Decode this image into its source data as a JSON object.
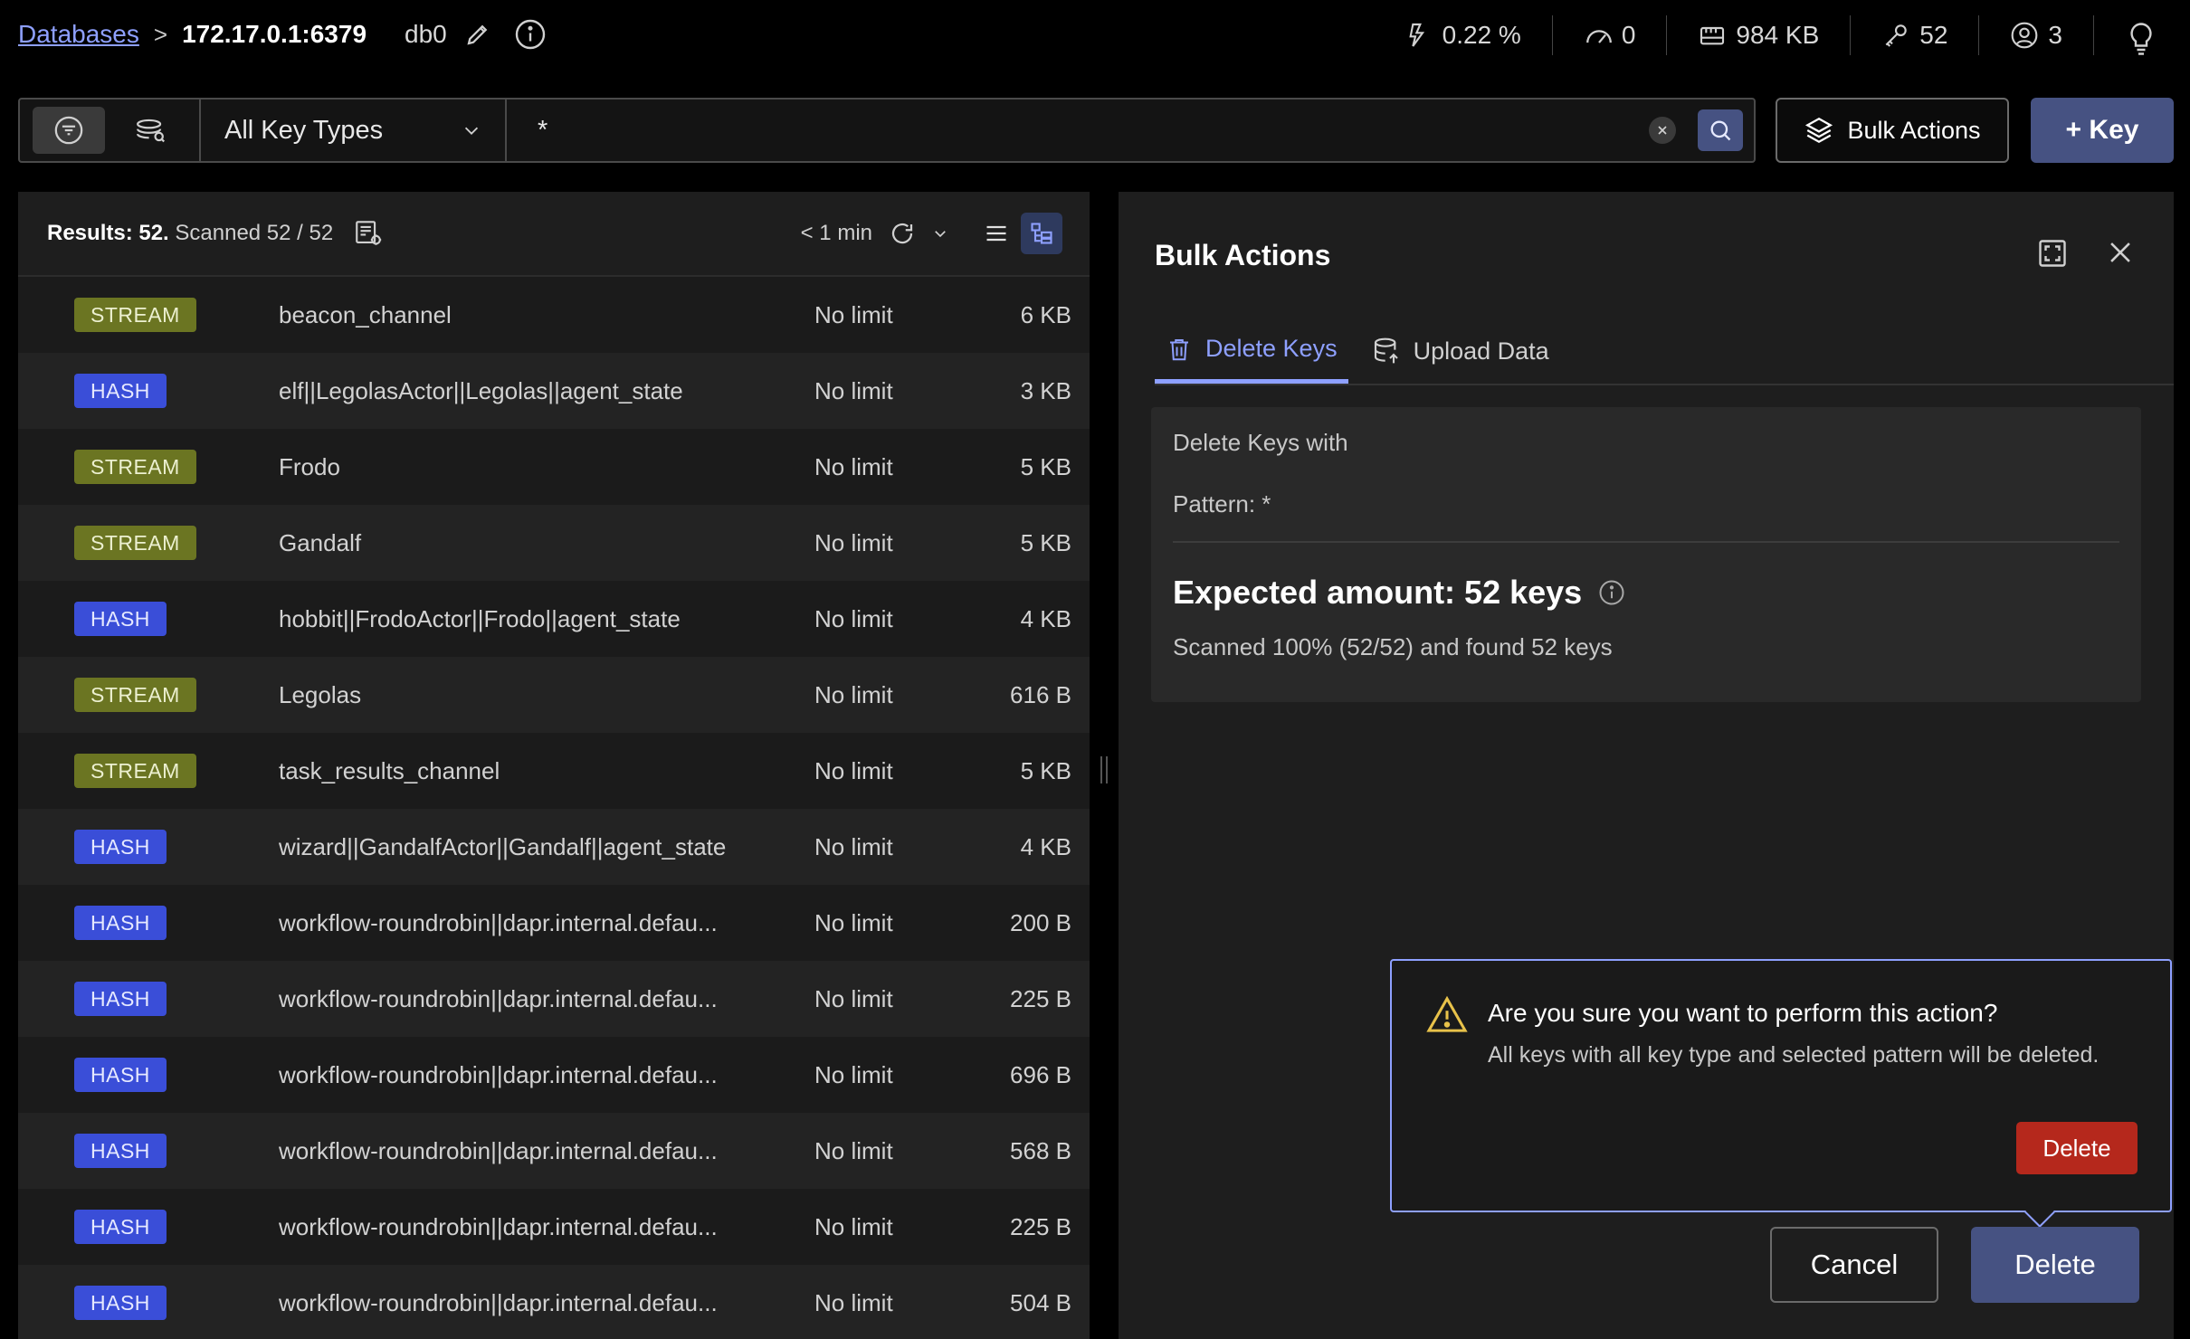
{
  "breadcrumb": {
    "databases_link": "Databases",
    "separator": ">",
    "host": "172.17.0.1:6379",
    "db": "db0"
  },
  "stats": {
    "cpu": "0.22 %",
    "ops": "0",
    "memory": "984 KB",
    "keys": "52",
    "clients": "3"
  },
  "filter": {
    "key_type": "All Key Types",
    "pattern": "*"
  },
  "toolbar": {
    "bulk_actions_label": "Bulk Actions",
    "add_key_label": "+ Key"
  },
  "list": {
    "results_label": "Results: 52.",
    "scanned_label": "Scanned 52 / 52",
    "refresh_label": "< 1 min",
    "rows": [
      {
        "type": "STREAM",
        "name": "beacon_channel",
        "ttl": "No limit",
        "size": "6 KB"
      },
      {
        "type": "HASH",
        "name": "elf||LegolasActor||Legolas||agent_state",
        "ttl": "No limit",
        "size": "3 KB"
      },
      {
        "type": "STREAM",
        "name": "Frodo",
        "ttl": "No limit",
        "size": "5 KB"
      },
      {
        "type": "STREAM",
        "name": "Gandalf",
        "ttl": "No limit",
        "size": "5 KB"
      },
      {
        "type": "HASH",
        "name": "hobbit||FrodoActor||Frodo||agent_state",
        "ttl": "No limit",
        "size": "4 KB"
      },
      {
        "type": "STREAM",
        "name": "Legolas",
        "ttl": "No limit",
        "size": "616 B"
      },
      {
        "type": "STREAM",
        "name": "task_results_channel",
        "ttl": "No limit",
        "size": "5 KB"
      },
      {
        "type": "HASH",
        "name": "wizard||GandalfActor||Gandalf||agent_state",
        "ttl": "No limit",
        "size": "4 KB"
      },
      {
        "type": "HASH",
        "name": "workflow-roundrobin||dapr.internal.defau...",
        "ttl": "No limit",
        "size": "200 B"
      },
      {
        "type": "HASH",
        "name": "workflow-roundrobin||dapr.internal.defau...",
        "ttl": "No limit",
        "size": "225 B"
      },
      {
        "type": "HASH",
        "name": "workflow-roundrobin||dapr.internal.defau...",
        "ttl": "No limit",
        "size": "696 B"
      },
      {
        "type": "HASH",
        "name": "workflow-roundrobin||dapr.internal.defau...",
        "ttl": "No limit",
        "size": "568 B"
      },
      {
        "type": "HASH",
        "name": "workflow-roundrobin||dapr.internal.defau...",
        "ttl": "No limit",
        "size": "225 B"
      },
      {
        "type": "HASH",
        "name": "workflow-roundrobin||dapr.internal.defau...",
        "ttl": "No limit",
        "size": "504 B"
      }
    ]
  },
  "bulk": {
    "title": "Bulk Actions",
    "tabs": [
      "Delete Keys",
      "Upload Data"
    ],
    "delete_with": "Delete Keys with",
    "pattern": "Pattern: *",
    "expected": "Expected amount: 52 keys",
    "scanned": "Scanned 100% (52/52) and found 52 keys",
    "confirm_question": "Are you sure you want to perform this action?",
    "confirm_desc": "All keys with all key type and selected pattern will be deleted.",
    "confirm_delete": "Delete",
    "cancel": "Cancel",
    "delete": "Delete"
  },
  "colors": {
    "accent": "#465282",
    "link": "#8ea0ff",
    "stream_badge": "#6b7522",
    "hash_badge": "#3a4ed8",
    "danger": "#b5281c"
  }
}
